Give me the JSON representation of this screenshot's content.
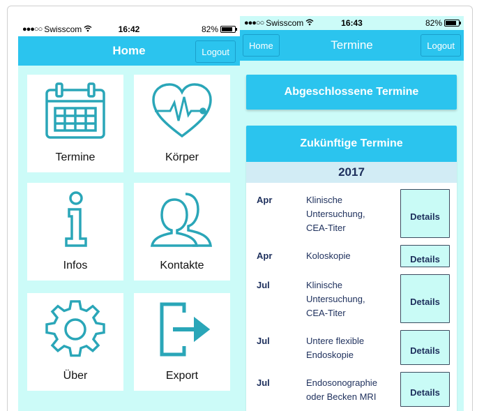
{
  "left_phone": {
    "status": {
      "carrier": "Swisscom",
      "time": "16:42",
      "battery": "82%"
    },
    "nav": {
      "title": "Home",
      "logout_label": "Logout"
    },
    "tiles": [
      {
        "label": "Termine",
        "icon": "calendar-icon"
      },
      {
        "label": "Körper",
        "icon": "heart-pulse-icon"
      },
      {
        "label": "Infos",
        "icon": "info-icon"
      },
      {
        "label": "Kontakte",
        "icon": "contacts-icon"
      },
      {
        "label": "Über",
        "icon": "gear-icon"
      },
      {
        "label": "Export",
        "icon": "export-icon"
      }
    ]
  },
  "right_phone": {
    "status": {
      "carrier": "Swisscom",
      "time": "16:43",
      "battery": "82%"
    },
    "nav": {
      "title": "Termine",
      "home_label": "Home",
      "logout_label": "Logout"
    },
    "past_button": "Abgeschlossene Termine",
    "future": {
      "title": "Zukünftige Termine",
      "year": "2017",
      "details_label": "Details",
      "rows": [
        {
          "month": "Apr",
          "lines": [
            "Klinische",
            "Untersuchung,",
            "CEA-Titer"
          ]
        },
        {
          "month": "Apr",
          "lines": [
            "Koloskopie"
          ]
        },
        {
          "month": "Jul",
          "lines": [
            "Klinische",
            "Untersuchung,",
            "CEA-Titer"
          ]
        },
        {
          "month": "Jul",
          "lines": [
            "Untere flexible",
            "Endoskopie"
          ]
        },
        {
          "month": "Jul",
          "lines": [
            "Endosonographie",
            "oder Becken MRI"
          ]
        }
      ]
    }
  },
  "colors": {
    "accent": "#2bc4ee",
    "background": "#ccfbf8",
    "icon": "#2aa6b8",
    "text_dark": "#1d2f5c"
  }
}
